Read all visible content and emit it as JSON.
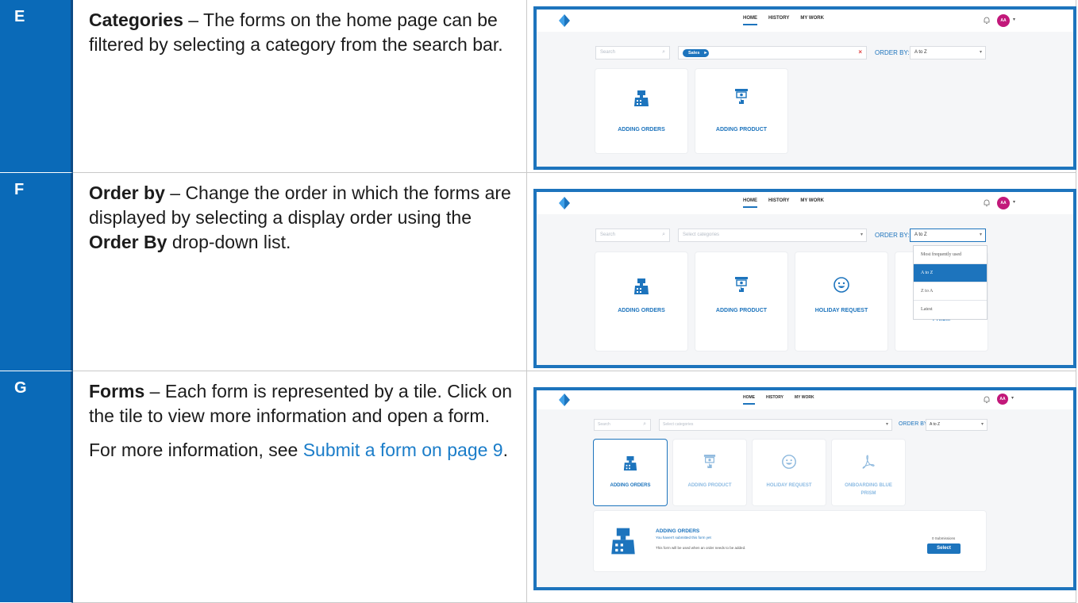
{
  "rows": [
    {
      "letter": "E",
      "title": "Categories",
      "text": " – The forms on the home page can be filtered by selecting a category from the search bar."
    },
    {
      "letter": "F",
      "title": "Order by",
      "text_before": " – Change the order in which the forms are displayed by selecting a display order using the ",
      "bold_mid": "Order By",
      "text_after": " drop-down list."
    },
    {
      "letter": "G",
      "title": "Forms",
      "text": " – Each form is represented by a tile. Click on the tile to view more information and open a form.",
      "para2_before": "For more information, see ",
      "link_text": "Submit a form on page 9",
      "para2_after": "."
    }
  ],
  "app": {
    "nav": {
      "home": "HOME",
      "history": "HISTORY",
      "my_work": "MY WORK"
    },
    "avatar_initials": "AA",
    "search_placeholder": "Search",
    "categories_placeholder": "Select categories",
    "selected_category": "Sales",
    "order_by_label": "ORDER BY:",
    "order_by_value": "A to Z",
    "order_options": [
      "Most frequently used",
      "A to Z",
      "Z to A",
      "Latest"
    ],
    "tiles": {
      "adding_orders": "ADDING ORDERS",
      "adding_product": "ADDING PRODUCT",
      "holiday_request": "HOLIDAY REQUEST",
      "onboarding_line1": "ONBOARDING BLUE",
      "onboarding_line2": "PRISM",
      "onboarding_partial": "PRISM"
    },
    "detail": {
      "title": "ADDING ORDERS",
      "status": "You haven't submitted this form yet",
      "description": "This form will be used when an order needs to be added.",
      "submissions": "0 Submissions",
      "select_button": "Select"
    }
  },
  "colors": {
    "band": "#0a6ab8",
    "frame": "#1d74bd",
    "avatar": "#c2187a",
    "link": "#1b7dc9"
  }
}
